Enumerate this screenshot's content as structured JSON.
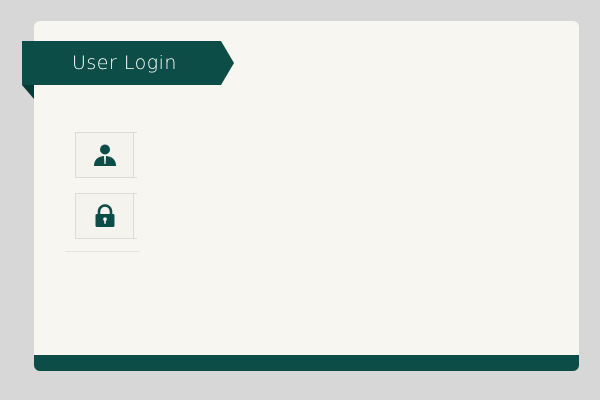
{
  "header": {
    "title": "User Login"
  },
  "fields": {
    "username": {
      "icon": "user-icon",
      "value": "",
      "placeholder": ""
    },
    "password": {
      "icon": "lock-icon",
      "value": "",
      "placeholder": ""
    }
  },
  "colors": {
    "accent": "#0d4d47",
    "background": "#d6d7d6",
    "card": "#f7f6f1"
  }
}
